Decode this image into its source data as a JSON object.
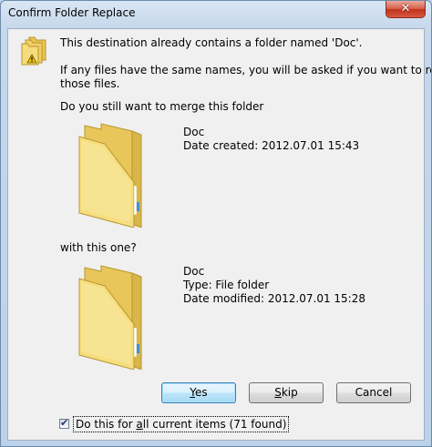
{
  "window": {
    "title": "Confirm Folder Replace",
    "close_glyph": "✕"
  },
  "message": {
    "line1": "This destination already contains a folder named 'Doc'.",
    "line2": "If any files have the same names, you will be asked if you want to replace",
    "line3": "those files.",
    "question": "Do you still want to merge this folder"
  },
  "destination_folder": {
    "name": "Doc",
    "detail": "Date created: 2012.07.01 15:43"
  },
  "separator_text": "with this one?",
  "source_folder": {
    "name": "Doc",
    "type": "Type: File folder",
    "modified": "Date modified: 2012.07.01 15:28"
  },
  "buttons": {
    "yes_access": "Y",
    "yes_rest": "es",
    "skip_access": "S",
    "skip_rest": "kip",
    "cancel": "Cancel"
  },
  "apply_all": {
    "checked": true,
    "check_glyph": "✔",
    "label_pre": "Do this for ",
    "label_access": "a",
    "label_post": "ll current items (71 found)"
  },
  "colors": {
    "folder": "#f2d46a",
    "default_button_border": "#3c7fb1",
    "close_button": "#c2321e"
  }
}
